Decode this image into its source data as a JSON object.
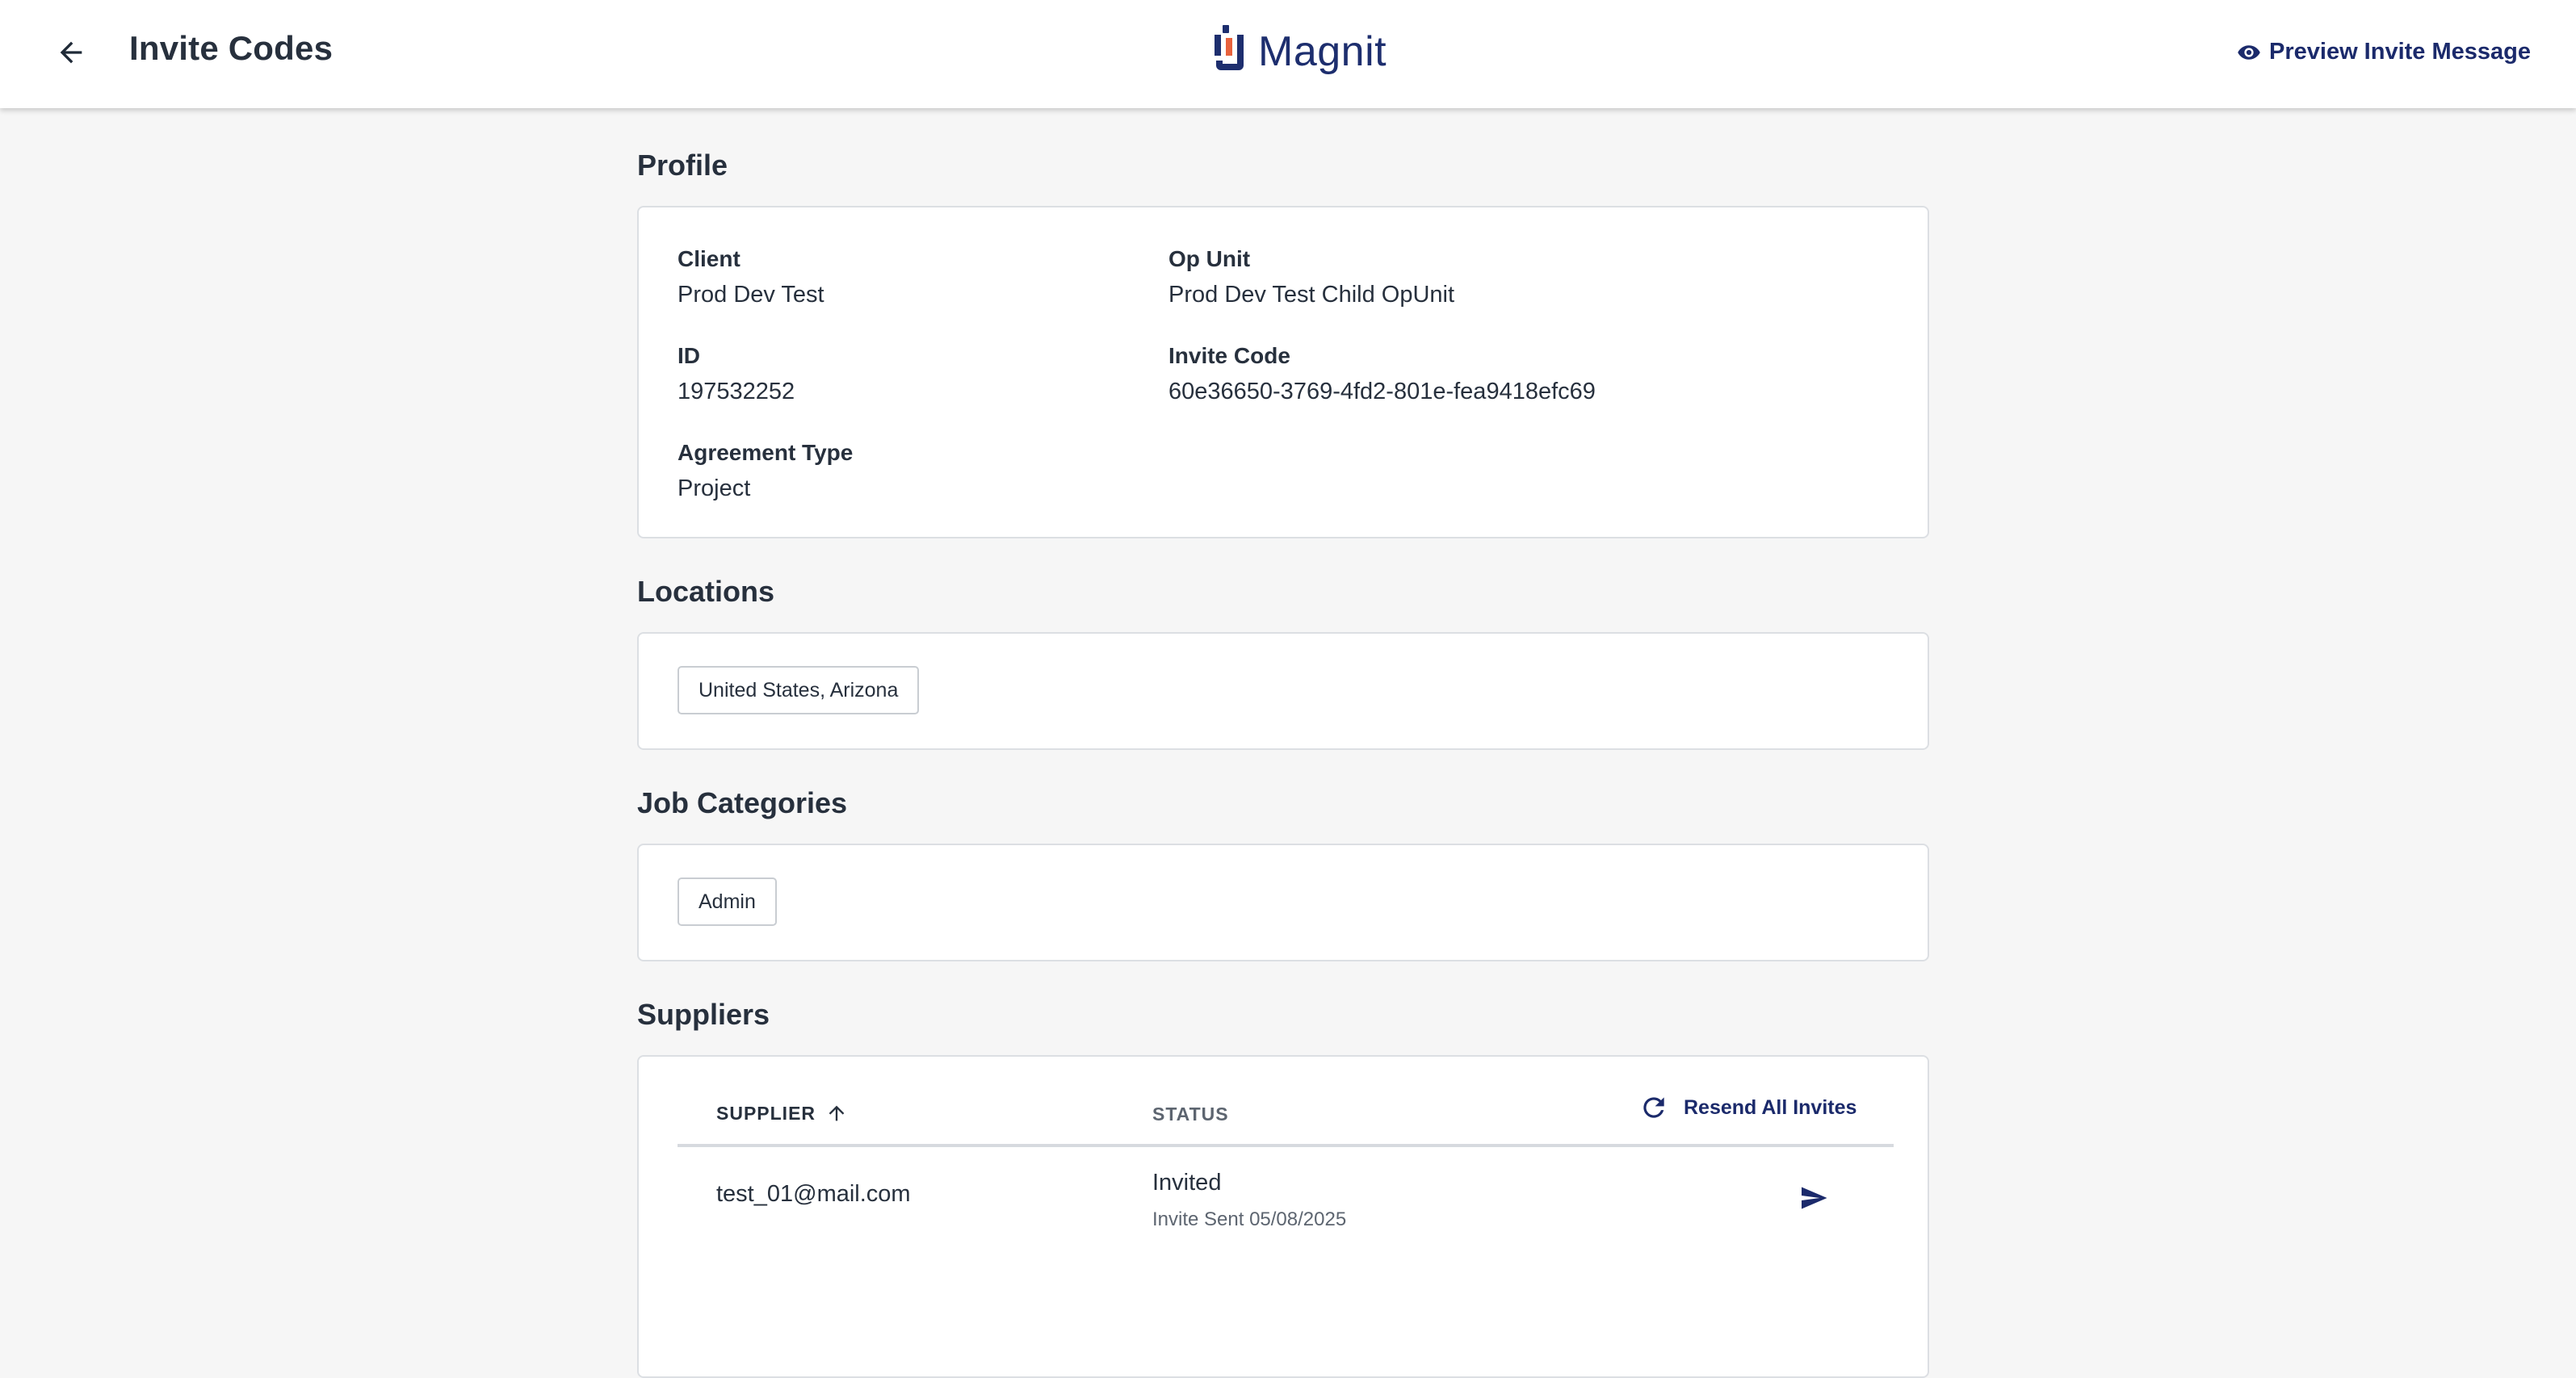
{
  "header": {
    "title": "Invite Codes",
    "logo_text": "Magnit",
    "preview_label": "Preview Invite Message"
  },
  "profile": {
    "heading": "Profile",
    "fields": {
      "client": {
        "label": "Client",
        "value": "Prod Dev Test"
      },
      "op_unit": {
        "label": "Op Unit",
        "value": "Prod Dev Test Child OpUnit"
      },
      "id": {
        "label": "ID",
        "value": "197532252"
      },
      "invite_code": {
        "label": "Invite Code",
        "value": "60e36650-3769-4fd2-801e-fea9418efc69"
      },
      "agreement_type": {
        "label": "Agreement Type",
        "value": "Project"
      }
    }
  },
  "locations": {
    "heading": "Locations",
    "chips": [
      "United States, Arizona"
    ]
  },
  "job_categories": {
    "heading": "Job Categories",
    "chips": [
      "Admin"
    ]
  },
  "suppliers": {
    "heading": "Suppliers",
    "columns": {
      "supplier": "SUPPLIER",
      "status": "STATUS"
    },
    "resend_all_label": "Resend All Invites",
    "rows": [
      {
        "email": "test_01@mail.com",
        "status": "Invited",
        "status_detail": "Invite Sent 05/08/2025"
      }
    ]
  },
  "colors": {
    "brand_navy": "#1d2e6e",
    "brand_orange": "#e8623d",
    "text_dark": "#27303d",
    "page_bg": "#f6f6f6"
  },
  "icons": {
    "back": "arrow-left-icon",
    "preview": "eye-icon",
    "sort": "arrow-up-icon",
    "resend": "refresh-icon",
    "send": "send-icon"
  }
}
